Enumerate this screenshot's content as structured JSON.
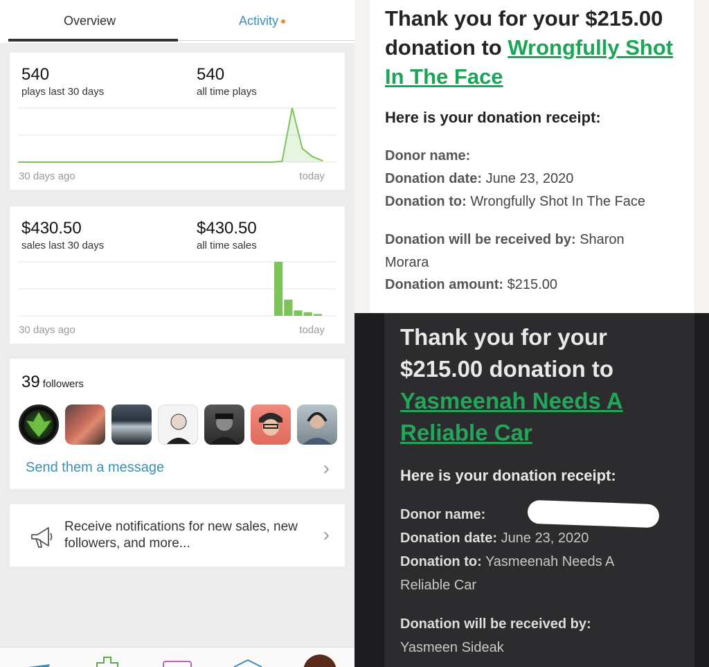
{
  "tabs": {
    "overview": "Overview",
    "activity": "Activity"
  },
  "plays": {
    "last30_value": "540",
    "last30_label": "plays last 30 days",
    "alltime_value": "540",
    "alltime_label": "all time plays",
    "axis_left": "30 days ago",
    "axis_right": "today"
  },
  "sales": {
    "last30_value": "$430.50",
    "last30_label": "sales last 30 days",
    "alltime_value": "$430.50",
    "alltime_label": "all time sales",
    "axis_left": "30 days ago",
    "axis_right": "today"
  },
  "followers": {
    "count": "39",
    "word": "followers",
    "message_link": "Send them a message"
  },
  "notifications": {
    "text": "Receive notifications for new sales, new followers, and more..."
  },
  "receipt1": {
    "headline_prefix": "Thank you for your $215.00 donation to ",
    "headline_link": "Wrongfully Shot In The Face",
    "receipt_title": "Here is your donation receipt:",
    "donor_name_label": "Donor name:",
    "date_label": "Donation date:",
    "date_value": "June 23, 2020",
    "to_label": "Donation to:",
    "to_value": "Wrongfully Shot In The Face",
    "received_label": "Donation will be received by:",
    "received_value_1": "Sharon",
    "received_value_2": "Morara",
    "amount_label": "Donation amount:",
    "amount_value": "$215.00"
  },
  "receipt2": {
    "headline_line1": "Thank you for your",
    "headline_line2": "$215.00 donation to",
    "headline_link1": "Yasmeenah Needs A",
    "headline_link2": "Reliable Car",
    "receipt_title": "Here is your donation receipt:",
    "donor_name_label": "Donor name:",
    "date_label": "Donation date:",
    "date_value": "June 23, 2020",
    "to_label": "Donation to:",
    "to_value_1": "Yasmeenah Needs A",
    "to_value_2": "Reliable Car",
    "received_label": "Donation will be received by:",
    "received_value": "Yasmeen Sideak"
  },
  "colors": {
    "accent_blue": "#3a8fb3",
    "chart_green": "#7cc35a",
    "link_green": "#19a657",
    "notification_dot": "#ef8a2c"
  },
  "chart_data": [
    {
      "type": "line",
      "title": "plays",
      "x": [
        "30 days ago",
        "today"
      ],
      "values_last_days": [
        0,
        0,
        0,
        0,
        0,
        0,
        0,
        0,
        0,
        0,
        0,
        0,
        0,
        0,
        0,
        0,
        0,
        0,
        0,
        0,
        0,
        0,
        0,
        0,
        0,
        0,
        5,
        400,
        100,
        40,
        10
      ],
      "note_grid": true
    },
    {
      "type": "bar",
      "title": "sales",
      "x": [
        "30 days ago",
        "today"
      ],
      "values_last_days": [
        0,
        0,
        0,
        0,
        0,
        0,
        0,
        0,
        0,
        0,
        0,
        0,
        0,
        0,
        0,
        0,
        0,
        0,
        0,
        0,
        0,
        0,
        0,
        0,
        0,
        0,
        300,
        90,
        30,
        20,
        10
      ],
      "note_grid": true
    }
  ]
}
